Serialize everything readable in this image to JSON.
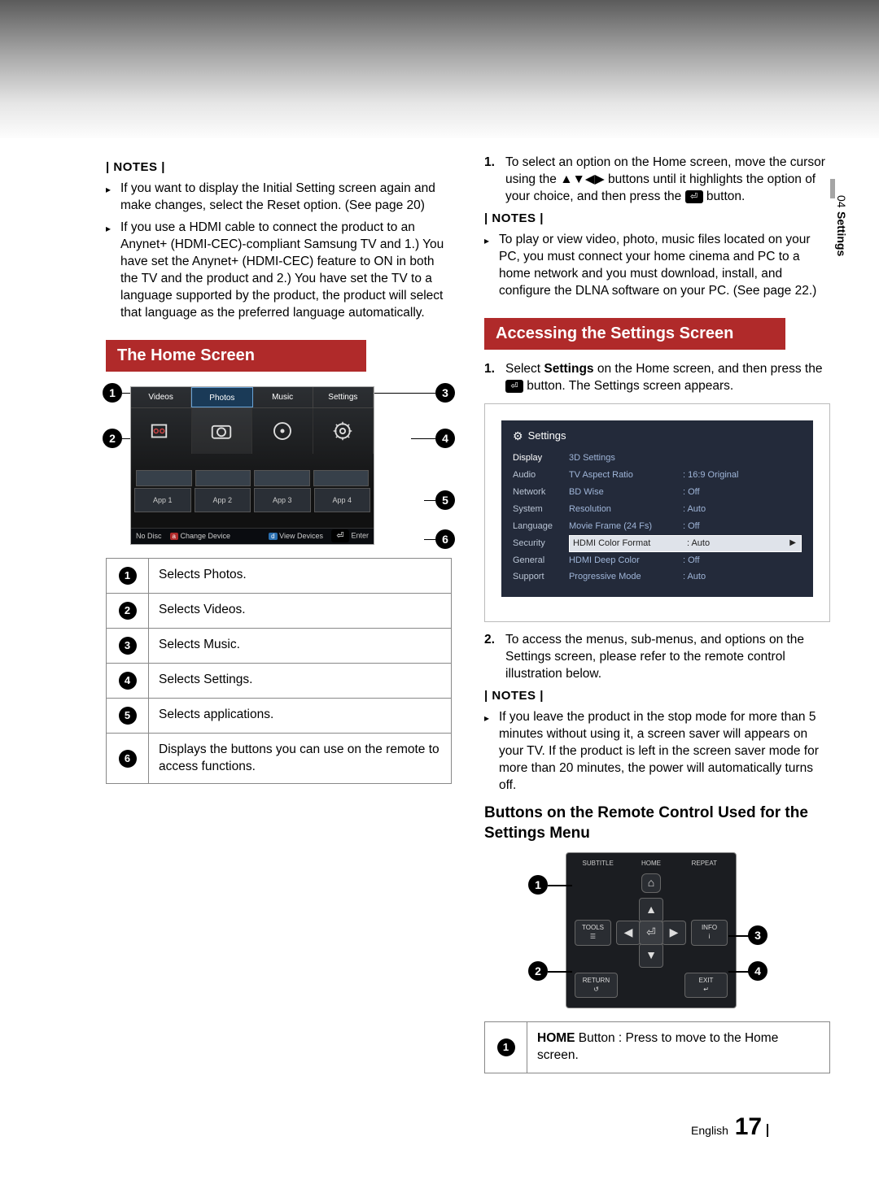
{
  "side": {
    "chapter": "04",
    "label": "Settings"
  },
  "left": {
    "notes1_hdr": "| NOTES |",
    "notes1": [
      "If you want to display the Initial Setting screen again and make changes, select the Reset option. (See page 20)",
      "If you use a HDMI cable to connect the product to an Anynet+ (HDMI-CEC)-compliant Samsung TV and 1.) You have set the Anynet+ (HDMI-CEC) feature to ON in both the TV and the product and 2.) You have set the TV to a language supported by the product, the product will select that language as the preferred language automatically."
    ],
    "section1": "The Home Screen",
    "hs": {
      "tabs": [
        "Videos",
        "Photos",
        "Music",
        "Settings"
      ],
      "apps": [
        "App 1",
        "App 2",
        "App 3",
        "App 4"
      ],
      "bottom": {
        "nodisc": "No Disc",
        "a": "Change Device",
        "d": "View Devices",
        "e": "Enter"
      }
    },
    "table": [
      "Selects Photos.",
      "Selects Videos.",
      "Selects Music.",
      "Selects Settings.",
      "Selects applications.",
      "Displays the buttons you can use on the remote to access functions."
    ]
  },
  "right": {
    "step1a": "To select an option on the Home screen, move the cursor using the ",
    "step1b": " buttons until it highlights the option of your choice, and then press the ",
    "step1c": " button.",
    "arrows": "▲▼◀▶",
    "notes2_hdr": "| NOTES |",
    "notes2": [
      "To play or view video, photo, music files located on your PC, you must connect your home cinema and PC to a home network and you must download, install, and configure the DLNA software on your PC. (See page 22.)"
    ],
    "section2": "Accessing the Settings Screen",
    "acc1a": "Select ",
    "acc1b": "Settings",
    "acc1c": " on the Home screen, and then press the ",
    "acc1d": " button. The Settings screen appears.",
    "settings": {
      "title": "Settings",
      "leftItems": [
        "Display",
        "Audio",
        "Network",
        "System",
        "Language",
        "Security",
        "General",
        "Support"
      ],
      "rows": [
        {
          "lab": "3D Settings",
          "val": ""
        },
        {
          "lab": "TV Aspect Ratio",
          "val": "16:9 Original"
        },
        {
          "lab": "BD Wise",
          "val": "Off"
        },
        {
          "lab": "Resolution",
          "val": "Auto"
        },
        {
          "lab": "Movie Frame (24 Fs)",
          "val": "Off"
        },
        {
          "lab": "HDMI Color Format",
          "val": "Auto"
        },
        {
          "lab": "HDMI Deep Color",
          "val": "Off"
        },
        {
          "lab": "Progressive Mode",
          "val": "Auto"
        }
      ],
      "selIndex": 5
    },
    "acc2": "To access the menus, sub-menus, and options on the Settings screen, please refer to the remote control illustration below.",
    "notes3_hdr": "| NOTES |",
    "notes3": [
      "If you leave the product in the stop mode for more than 5 minutes without using it, a screen saver will appears on your TV. If the product is left in the screen saver mode for more than 20 minutes, the power will automatically turns off."
    ],
    "subhead": "Buttons on the Remote Control Used for the Settings Menu",
    "remote": {
      "top": [
        "SUBTITLE",
        "HOME",
        "REPEAT"
      ],
      "sideL": {
        "t": "TOOLS",
        "i": "☰"
      },
      "sideR": {
        "t": "INFO",
        "i": "i"
      },
      "botL": {
        "t": "RETURN",
        "i": "↺"
      },
      "botR": {
        "t": "EXIT",
        "i": "↵"
      }
    },
    "table2": {
      "home_label": "HOME",
      "home_text": " Button : Press to move to the Home screen."
    }
  },
  "footer": {
    "lang": "English",
    "page": "17"
  }
}
